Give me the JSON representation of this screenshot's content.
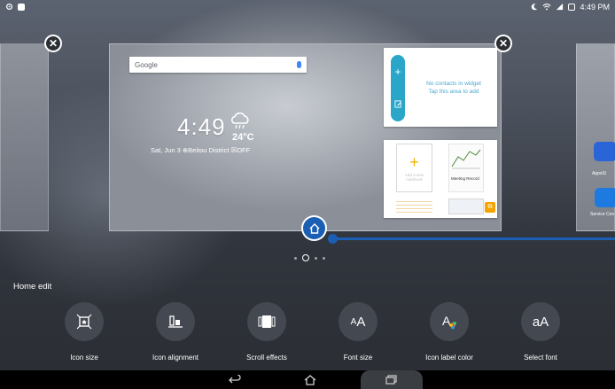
{
  "status_bar": {
    "time": "4:49 PM",
    "left_icons": [
      "settings-icon",
      "notification-icon"
    ],
    "right_icons": [
      "moon-icon",
      "wifi-icon",
      "signal-icon",
      "battery-icon"
    ]
  },
  "preview": {
    "search": {
      "logo": "Google",
      "mic_icon": "mic-icon"
    },
    "clock": {
      "time": "4:49",
      "temperature": "24°C",
      "date_line": "Sat, Jun 3 ⊕Beitou District ☒OFF"
    },
    "contacts_widget": {
      "text_line1": "No contacts in widget",
      "text_line2": "Tap this area to add"
    },
    "notebook_widget": {
      "add_text": "Add a new notebook",
      "page_title": "Meeting Record"
    },
    "right_apps": [
      {
        "label": "AppsIU"
      },
      {
        "label": "Service Cen"
      }
    ]
  },
  "panel": {
    "title": "Home edit",
    "tools": [
      {
        "label": "Icon size",
        "icon": "icon-size-icon"
      },
      {
        "label": "Icon alignment",
        "icon": "icon-alignment-icon"
      },
      {
        "label": "Scroll effects",
        "icon": "scroll-effects-icon"
      },
      {
        "label": "Font size",
        "icon": "font-size-icon"
      },
      {
        "label": "Icon label color",
        "icon": "icon-label-color-icon"
      },
      {
        "label": "Select font",
        "icon": "select-font-icon"
      }
    ]
  },
  "navbar": {
    "back": "back-icon",
    "home": "home-icon",
    "recent": "recent-apps-icon"
  },
  "colors": {
    "accent": "#1a5fb4",
    "contacts": "#2aa6c9",
    "notebook": "#f4b400"
  }
}
